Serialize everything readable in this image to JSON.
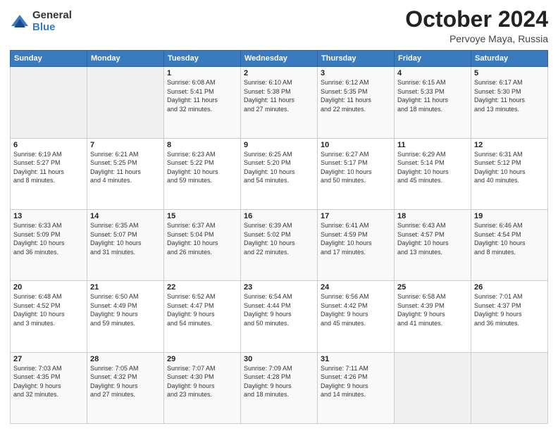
{
  "logo": {
    "general": "General",
    "blue": "Blue"
  },
  "header": {
    "month": "October 2024",
    "location": "Pervoye Maya, Russia"
  },
  "weekdays": [
    "Sunday",
    "Monday",
    "Tuesday",
    "Wednesday",
    "Thursday",
    "Friday",
    "Saturday"
  ],
  "weeks": [
    [
      {
        "num": "",
        "detail": ""
      },
      {
        "num": "",
        "detail": ""
      },
      {
        "num": "1",
        "detail": "Sunrise: 6:08 AM\nSunset: 5:41 PM\nDaylight: 11 hours\nand 32 minutes."
      },
      {
        "num": "2",
        "detail": "Sunrise: 6:10 AM\nSunset: 5:38 PM\nDaylight: 11 hours\nand 27 minutes."
      },
      {
        "num": "3",
        "detail": "Sunrise: 6:12 AM\nSunset: 5:35 PM\nDaylight: 11 hours\nand 22 minutes."
      },
      {
        "num": "4",
        "detail": "Sunrise: 6:15 AM\nSunset: 5:33 PM\nDaylight: 11 hours\nand 18 minutes."
      },
      {
        "num": "5",
        "detail": "Sunrise: 6:17 AM\nSunset: 5:30 PM\nDaylight: 11 hours\nand 13 minutes."
      }
    ],
    [
      {
        "num": "6",
        "detail": "Sunrise: 6:19 AM\nSunset: 5:27 PM\nDaylight: 11 hours\nand 8 minutes."
      },
      {
        "num": "7",
        "detail": "Sunrise: 6:21 AM\nSunset: 5:25 PM\nDaylight: 11 hours\nand 4 minutes."
      },
      {
        "num": "8",
        "detail": "Sunrise: 6:23 AM\nSunset: 5:22 PM\nDaylight: 10 hours\nand 59 minutes."
      },
      {
        "num": "9",
        "detail": "Sunrise: 6:25 AM\nSunset: 5:20 PM\nDaylight: 10 hours\nand 54 minutes."
      },
      {
        "num": "10",
        "detail": "Sunrise: 6:27 AM\nSunset: 5:17 PM\nDaylight: 10 hours\nand 50 minutes."
      },
      {
        "num": "11",
        "detail": "Sunrise: 6:29 AM\nSunset: 5:14 PM\nDaylight: 10 hours\nand 45 minutes."
      },
      {
        "num": "12",
        "detail": "Sunrise: 6:31 AM\nSunset: 5:12 PM\nDaylight: 10 hours\nand 40 minutes."
      }
    ],
    [
      {
        "num": "13",
        "detail": "Sunrise: 6:33 AM\nSunset: 5:09 PM\nDaylight: 10 hours\nand 36 minutes."
      },
      {
        "num": "14",
        "detail": "Sunrise: 6:35 AM\nSunset: 5:07 PM\nDaylight: 10 hours\nand 31 minutes."
      },
      {
        "num": "15",
        "detail": "Sunrise: 6:37 AM\nSunset: 5:04 PM\nDaylight: 10 hours\nand 26 minutes."
      },
      {
        "num": "16",
        "detail": "Sunrise: 6:39 AM\nSunset: 5:02 PM\nDaylight: 10 hours\nand 22 minutes."
      },
      {
        "num": "17",
        "detail": "Sunrise: 6:41 AM\nSunset: 4:59 PM\nDaylight: 10 hours\nand 17 minutes."
      },
      {
        "num": "18",
        "detail": "Sunrise: 6:43 AM\nSunset: 4:57 PM\nDaylight: 10 hours\nand 13 minutes."
      },
      {
        "num": "19",
        "detail": "Sunrise: 6:46 AM\nSunset: 4:54 PM\nDaylight: 10 hours\nand 8 minutes."
      }
    ],
    [
      {
        "num": "20",
        "detail": "Sunrise: 6:48 AM\nSunset: 4:52 PM\nDaylight: 10 hours\nand 3 minutes."
      },
      {
        "num": "21",
        "detail": "Sunrise: 6:50 AM\nSunset: 4:49 PM\nDaylight: 9 hours\nand 59 minutes."
      },
      {
        "num": "22",
        "detail": "Sunrise: 6:52 AM\nSunset: 4:47 PM\nDaylight: 9 hours\nand 54 minutes."
      },
      {
        "num": "23",
        "detail": "Sunrise: 6:54 AM\nSunset: 4:44 PM\nDaylight: 9 hours\nand 50 minutes."
      },
      {
        "num": "24",
        "detail": "Sunrise: 6:56 AM\nSunset: 4:42 PM\nDaylight: 9 hours\nand 45 minutes."
      },
      {
        "num": "25",
        "detail": "Sunrise: 6:58 AM\nSunset: 4:39 PM\nDaylight: 9 hours\nand 41 minutes."
      },
      {
        "num": "26",
        "detail": "Sunrise: 7:01 AM\nSunset: 4:37 PM\nDaylight: 9 hours\nand 36 minutes."
      }
    ],
    [
      {
        "num": "27",
        "detail": "Sunrise: 7:03 AM\nSunset: 4:35 PM\nDaylight: 9 hours\nand 32 minutes."
      },
      {
        "num": "28",
        "detail": "Sunrise: 7:05 AM\nSunset: 4:32 PM\nDaylight: 9 hours\nand 27 minutes."
      },
      {
        "num": "29",
        "detail": "Sunrise: 7:07 AM\nSunset: 4:30 PM\nDaylight: 9 hours\nand 23 minutes."
      },
      {
        "num": "30",
        "detail": "Sunrise: 7:09 AM\nSunset: 4:28 PM\nDaylight: 9 hours\nand 18 minutes."
      },
      {
        "num": "31",
        "detail": "Sunrise: 7:11 AM\nSunset: 4:26 PM\nDaylight: 9 hours\nand 14 minutes."
      },
      {
        "num": "",
        "detail": ""
      },
      {
        "num": "",
        "detail": ""
      }
    ]
  ]
}
